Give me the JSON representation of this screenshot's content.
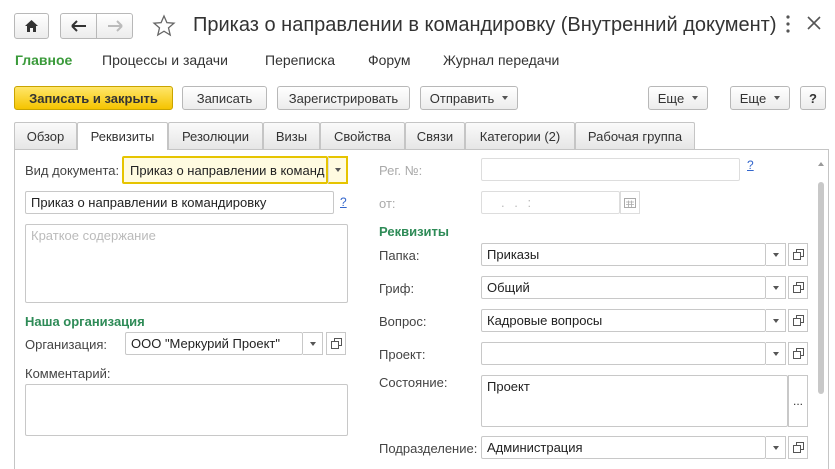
{
  "window": {
    "title": "Приказ о направлении в командировку (Внутренний документ)",
    "home_icon": "home-icon",
    "back_icon": "arrow-left-icon",
    "forward_icon": "arrow-right-icon",
    "favorite_icon": "star-icon",
    "menu_icon": "more-vertical-icon",
    "close_icon": "close-icon"
  },
  "nav": {
    "items": [
      {
        "label": "Главное",
        "active": true
      },
      {
        "label": "Процессы и задачи"
      },
      {
        "label": "Переписка"
      },
      {
        "label": "Форум"
      },
      {
        "label": "Журнал передачи"
      }
    ]
  },
  "toolbar": {
    "save_close": "Записать и закрыть",
    "save": "Записать",
    "register": "Зарегистрировать",
    "send": "Отправить",
    "more1": "Еще",
    "more2": "Еще",
    "help": "?"
  },
  "tabs": [
    "Обзор",
    "Реквизиты",
    "Резолюции",
    "Визы",
    "Свойства",
    "Связи",
    "Категории (2)",
    "Рабочая группа"
  ],
  "left": {
    "doc_type_label": "Вид документа:",
    "doc_type_value": "Приказ о направлении в команд",
    "title_value": "Приказ о направлении  в командировку",
    "help_mark": "?",
    "summary_placeholder": "Краткое содержание",
    "org_section": "Наша организация",
    "org_label": "Организация:",
    "org_value": "ООО \"Меркурий Проект\"",
    "comment_label": "Комментарий:"
  },
  "right": {
    "reg_label": "Рег. №:",
    "reg_help": "?",
    "from_label": "от:",
    "date_mask": ". .     :",
    "details_section": "Реквизиты",
    "folder_label": "Папка:",
    "folder_value": "Приказы",
    "stamp_label": "Гриф:",
    "stamp_value": "Общий",
    "question_label": "Вопрос:",
    "question_value": "Кадровые вопросы",
    "project_label": "Проект:",
    "project_value": "",
    "state_label": "Состояние:",
    "state_value": "Проект",
    "state_btn": "...",
    "dept_label": "Подразделение:",
    "dept_value": "Администрация"
  }
}
